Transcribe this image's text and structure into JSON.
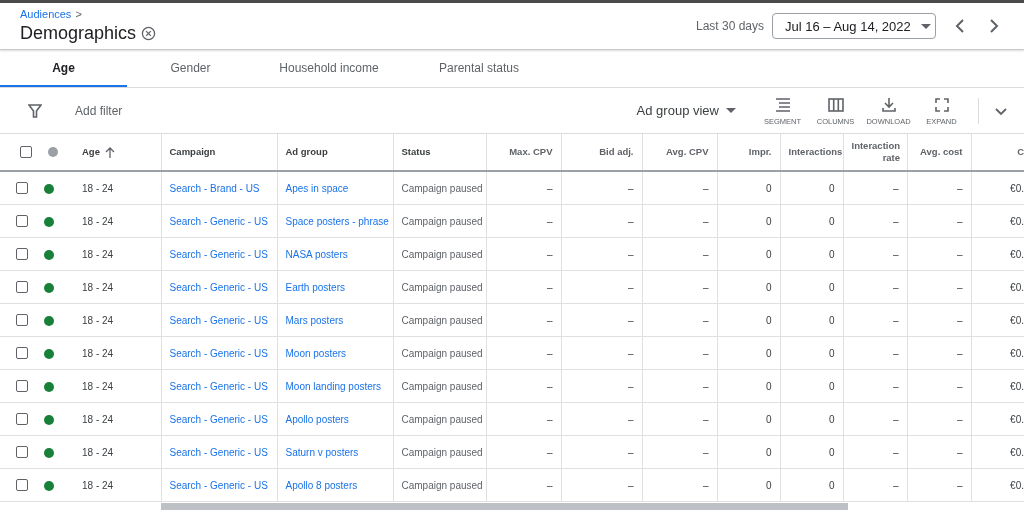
{
  "breadcrumb": {
    "parent": "Audiences",
    "separator": ">"
  },
  "page_title": "Demographics",
  "date_range": {
    "label": "Last 30 days",
    "value": "Jul 16 – Aug 14, 2022"
  },
  "tabs": [
    {
      "label": "Age",
      "selected": true
    },
    {
      "label": "Gender",
      "selected": false
    },
    {
      "label": "Household income",
      "selected": false
    },
    {
      "label": "Parental status",
      "selected": false
    }
  ],
  "toolbar": {
    "filter": "Add filter",
    "view": "Ad group view",
    "actions": [
      {
        "kind": "segment",
        "label": "SEGMENT"
      },
      {
        "kind": "columns",
        "label": "COLUMNS"
      },
      {
        "kind": "download",
        "label": "DOWNLOAD"
      },
      {
        "kind": "expand",
        "label": "EXPAND"
      }
    ]
  },
  "table": {
    "header_checked": false,
    "columns": [
      "Age",
      "Campaign",
      "Ad group",
      "Status",
      "Max. CPV",
      "Bid adj.",
      "Avg. CPV",
      "Impr.",
      "Interactions",
      "Interaction rate",
      "Avg. cost",
      "C"
    ],
    "rows": [
      {
        "checked": false,
        "color": "#188038",
        "cells": [
          "18 - 24",
          "Search - Brand - US",
          "Apes in space",
          "Campaign paused",
          "–",
          "–",
          "–",
          "0",
          "0",
          "–",
          "–",
          "€0."
        ]
      },
      {
        "checked": false,
        "color": "#188038",
        "cells": [
          "18 - 24",
          "Search - Generic - US",
          "Space posters - phrase",
          "Campaign paused",
          "–",
          "–",
          "–",
          "0",
          "0",
          "–",
          "–",
          "€0."
        ]
      },
      {
        "checked": false,
        "color": "#188038",
        "cells": [
          "18 - 24",
          "Search - Generic - US",
          "NASA posters",
          "Campaign paused",
          "–",
          "–",
          "–",
          "0",
          "0",
          "–",
          "–",
          "€0."
        ]
      },
      {
        "checked": false,
        "color": "#188038",
        "cells": [
          "18 - 24",
          "Search - Generic - US",
          "Earth posters",
          "Campaign paused",
          "–",
          "–",
          "–",
          "0",
          "0",
          "–",
          "–",
          "€0."
        ]
      },
      {
        "checked": false,
        "color": "#188038",
        "cells": [
          "18 - 24",
          "Search - Generic - US",
          "Mars posters",
          "Campaign paused",
          "–",
          "–",
          "–",
          "0",
          "0",
          "–",
          "–",
          "€0."
        ]
      },
      {
        "checked": false,
        "color": "#188038",
        "cells": [
          "18 - 24",
          "Search - Generic - US",
          "Moon posters",
          "Campaign paused",
          "–",
          "–",
          "–",
          "0",
          "0",
          "–",
          "–",
          "€0."
        ]
      },
      {
        "checked": false,
        "color": "#188038",
        "cells": [
          "18 - 24",
          "Search - Generic - US",
          "Moon landing posters",
          "Campaign paused",
          "–",
          "–",
          "–",
          "0",
          "0",
          "–",
          "–",
          "€0."
        ]
      },
      {
        "checked": false,
        "color": "#188038",
        "cells": [
          "18 - 24",
          "Search - Generic - US",
          "Apollo posters",
          "Campaign paused",
          "–",
          "–",
          "–",
          "0",
          "0",
          "–",
          "–",
          "€0."
        ]
      },
      {
        "checked": false,
        "color": "#188038",
        "cells": [
          "18 - 24",
          "Search - Generic - US",
          "Saturn v posters",
          "Campaign paused",
          "–",
          "–",
          "–",
          "0",
          "0",
          "–",
          "–",
          "€0."
        ]
      },
      {
        "checked": false,
        "color": "#188038",
        "cells": [
          "18 - 24",
          "Search - Generic - US",
          "Apollo 8 posters",
          "Campaign paused",
          "–",
          "–",
          "–",
          "0",
          "0",
          "–",
          "–",
          "€0."
        ]
      }
    ]
  }
}
